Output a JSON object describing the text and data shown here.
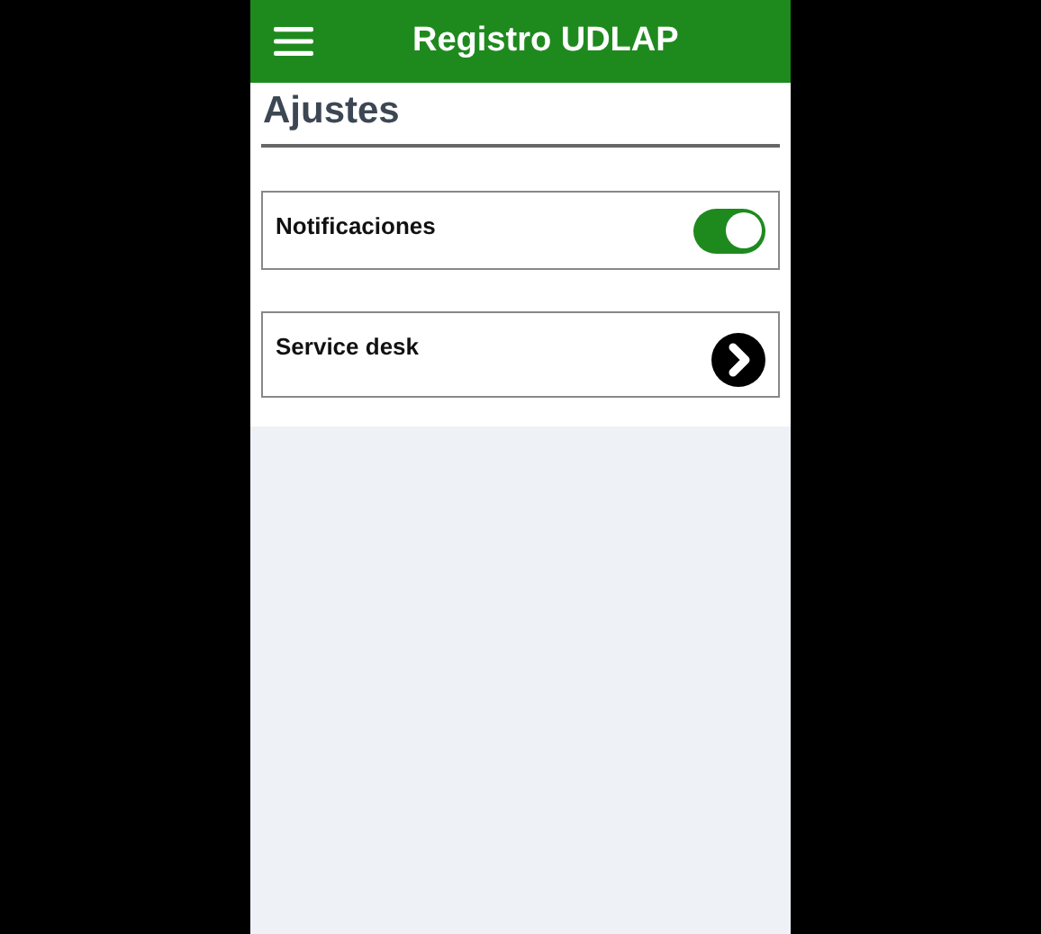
{
  "header": {
    "title": "Registro UDLAP"
  },
  "page": {
    "title": "Ajustes"
  },
  "settings": [
    {
      "kind": "toggle",
      "label": "Notificaciones",
      "on": true
    },
    {
      "kind": "link",
      "label": "Service desk"
    }
  ]
}
